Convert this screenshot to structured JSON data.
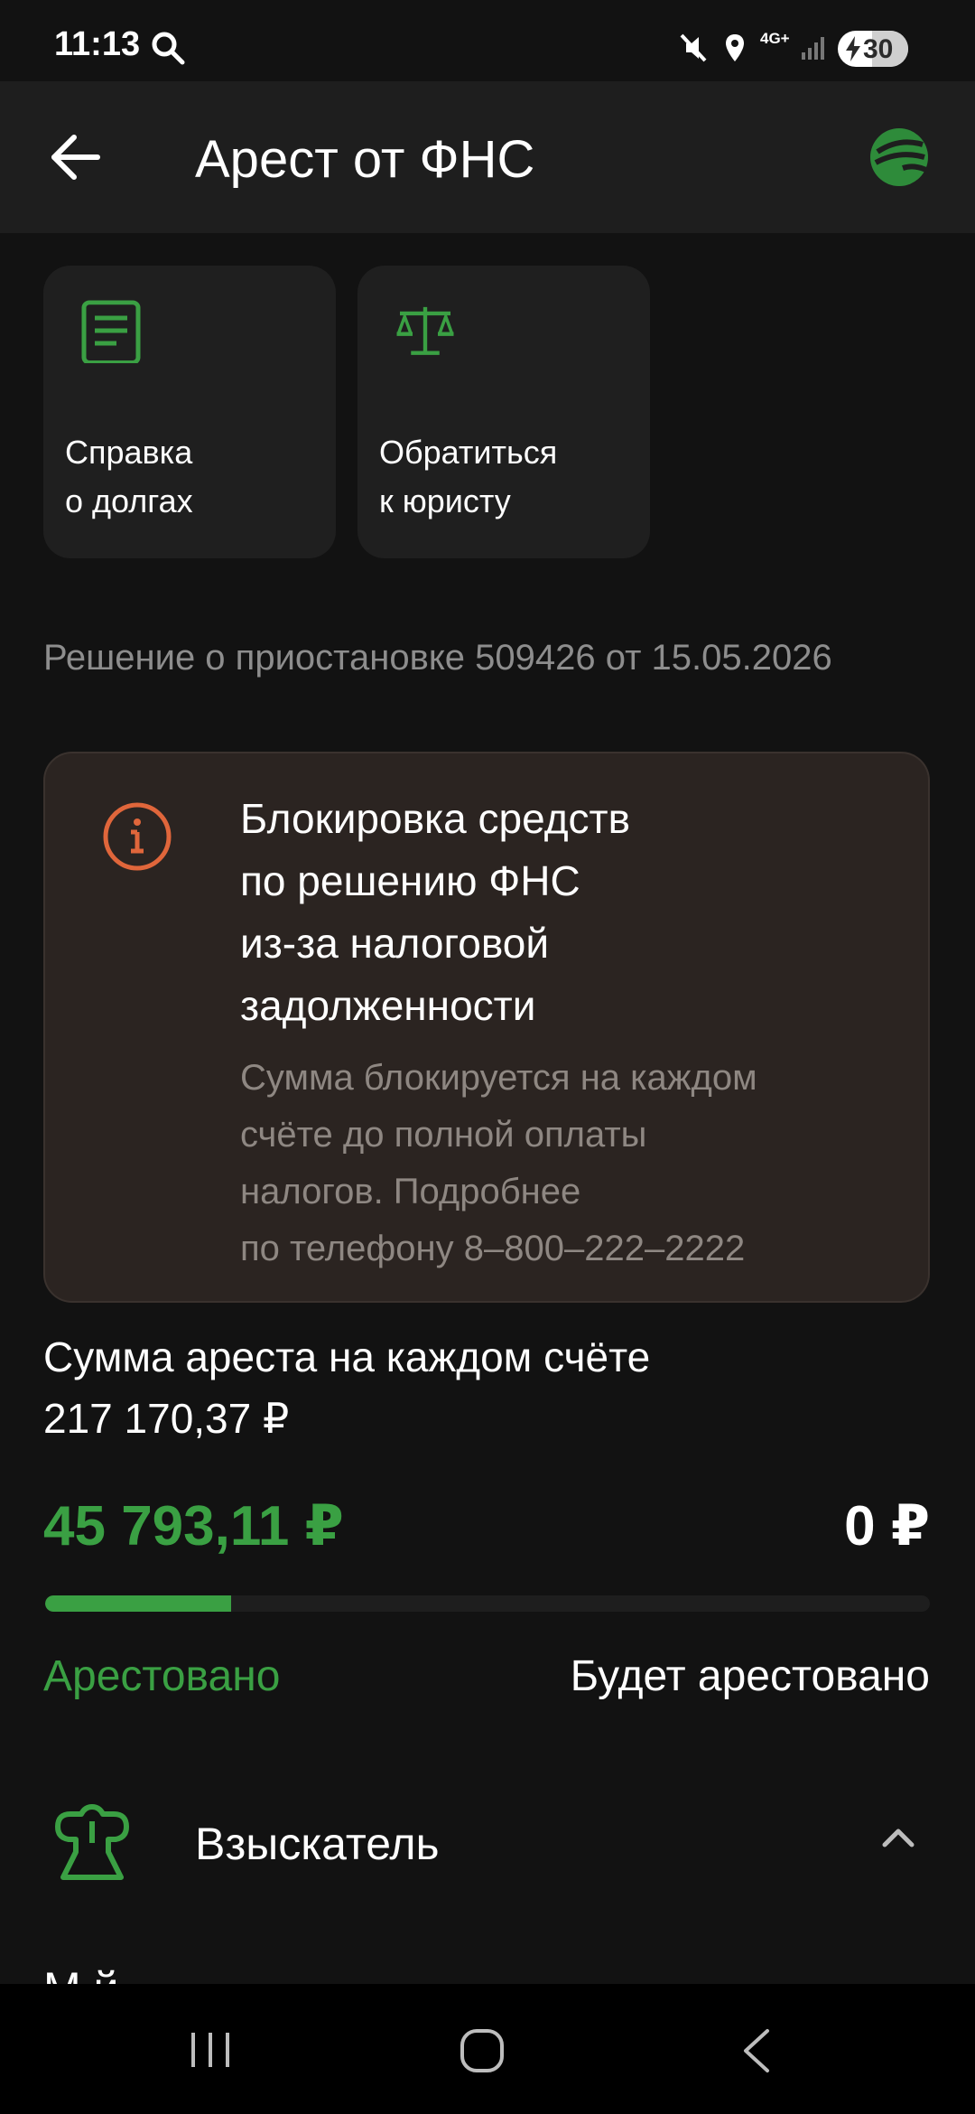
{
  "status_bar": {
    "time": "11:13",
    "network": "4G+",
    "battery": "30"
  },
  "app_bar": {
    "title": "Арест от ФНС"
  },
  "actions": [
    {
      "label": "Справка\nо долгах",
      "icon": "document-icon"
    },
    {
      "label": "Обратиться\nк юристу",
      "icon": "scales-icon"
    }
  ],
  "decision_text": "Решение о приостановке 509426 от 15.05.2026",
  "info_box": {
    "title": "Блокировка средств\nпо решению ФНС\nиз-за налоговой\nзадолженности",
    "text": "Сумма блокируется на каждом\nсчёте до полной оплаты\nналогов. Подробнее\nпо телефону 8–800–222–2222",
    "icon": "info-icon"
  },
  "arrest": {
    "label": "Сумма ареста на каждом счёте",
    "total": "217 170,37 ₽",
    "arrested_amount": "45 793,11 ₽",
    "remaining_amount": "0 ₽",
    "arrested_label": "Арестовано",
    "will_be_label": "Будет арестовано",
    "progress_fraction": 0.21
  },
  "collector": {
    "label": "Взыскатель",
    "cut_text": "М  й"
  },
  "colors": {
    "accent": "#3aa043",
    "background": "#121212",
    "warning": "#e0663b"
  }
}
